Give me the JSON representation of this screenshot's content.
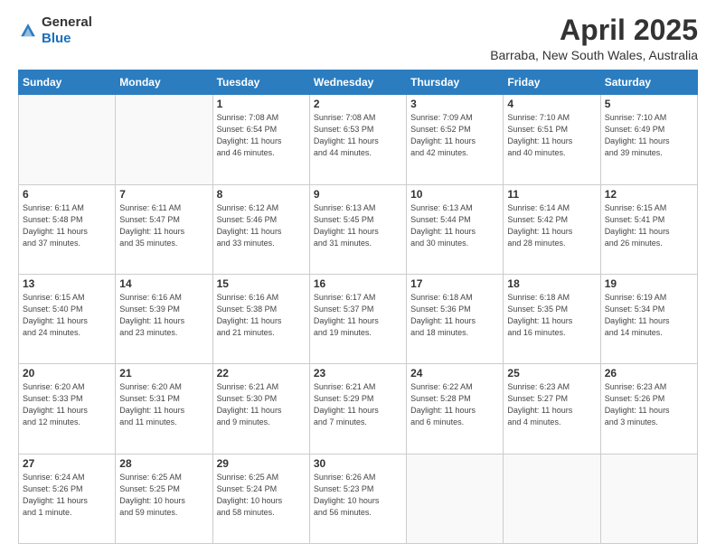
{
  "header": {
    "logo_general": "General",
    "logo_blue": "Blue",
    "title": "April 2025",
    "location": "Barraba, New South Wales, Australia"
  },
  "weekdays": [
    "Sunday",
    "Monday",
    "Tuesday",
    "Wednesday",
    "Thursday",
    "Friday",
    "Saturday"
  ],
  "weeks": [
    [
      {
        "day": "",
        "info": ""
      },
      {
        "day": "",
        "info": ""
      },
      {
        "day": "1",
        "info": "Sunrise: 7:08 AM\nSunset: 6:54 PM\nDaylight: 11 hours\nand 46 minutes."
      },
      {
        "day": "2",
        "info": "Sunrise: 7:08 AM\nSunset: 6:53 PM\nDaylight: 11 hours\nand 44 minutes."
      },
      {
        "day": "3",
        "info": "Sunrise: 7:09 AM\nSunset: 6:52 PM\nDaylight: 11 hours\nand 42 minutes."
      },
      {
        "day": "4",
        "info": "Sunrise: 7:10 AM\nSunset: 6:51 PM\nDaylight: 11 hours\nand 40 minutes."
      },
      {
        "day": "5",
        "info": "Sunrise: 7:10 AM\nSunset: 6:49 PM\nDaylight: 11 hours\nand 39 minutes."
      }
    ],
    [
      {
        "day": "6",
        "info": "Sunrise: 6:11 AM\nSunset: 5:48 PM\nDaylight: 11 hours\nand 37 minutes."
      },
      {
        "day": "7",
        "info": "Sunrise: 6:11 AM\nSunset: 5:47 PM\nDaylight: 11 hours\nand 35 minutes."
      },
      {
        "day": "8",
        "info": "Sunrise: 6:12 AM\nSunset: 5:46 PM\nDaylight: 11 hours\nand 33 minutes."
      },
      {
        "day": "9",
        "info": "Sunrise: 6:13 AM\nSunset: 5:45 PM\nDaylight: 11 hours\nand 31 minutes."
      },
      {
        "day": "10",
        "info": "Sunrise: 6:13 AM\nSunset: 5:44 PM\nDaylight: 11 hours\nand 30 minutes."
      },
      {
        "day": "11",
        "info": "Sunrise: 6:14 AM\nSunset: 5:42 PM\nDaylight: 11 hours\nand 28 minutes."
      },
      {
        "day": "12",
        "info": "Sunrise: 6:15 AM\nSunset: 5:41 PM\nDaylight: 11 hours\nand 26 minutes."
      }
    ],
    [
      {
        "day": "13",
        "info": "Sunrise: 6:15 AM\nSunset: 5:40 PM\nDaylight: 11 hours\nand 24 minutes."
      },
      {
        "day": "14",
        "info": "Sunrise: 6:16 AM\nSunset: 5:39 PM\nDaylight: 11 hours\nand 23 minutes."
      },
      {
        "day": "15",
        "info": "Sunrise: 6:16 AM\nSunset: 5:38 PM\nDaylight: 11 hours\nand 21 minutes."
      },
      {
        "day": "16",
        "info": "Sunrise: 6:17 AM\nSunset: 5:37 PM\nDaylight: 11 hours\nand 19 minutes."
      },
      {
        "day": "17",
        "info": "Sunrise: 6:18 AM\nSunset: 5:36 PM\nDaylight: 11 hours\nand 18 minutes."
      },
      {
        "day": "18",
        "info": "Sunrise: 6:18 AM\nSunset: 5:35 PM\nDaylight: 11 hours\nand 16 minutes."
      },
      {
        "day": "19",
        "info": "Sunrise: 6:19 AM\nSunset: 5:34 PM\nDaylight: 11 hours\nand 14 minutes."
      }
    ],
    [
      {
        "day": "20",
        "info": "Sunrise: 6:20 AM\nSunset: 5:33 PM\nDaylight: 11 hours\nand 12 minutes."
      },
      {
        "day": "21",
        "info": "Sunrise: 6:20 AM\nSunset: 5:31 PM\nDaylight: 11 hours\nand 11 minutes."
      },
      {
        "day": "22",
        "info": "Sunrise: 6:21 AM\nSunset: 5:30 PM\nDaylight: 11 hours\nand 9 minutes."
      },
      {
        "day": "23",
        "info": "Sunrise: 6:21 AM\nSunset: 5:29 PM\nDaylight: 11 hours\nand 7 minutes."
      },
      {
        "day": "24",
        "info": "Sunrise: 6:22 AM\nSunset: 5:28 PM\nDaylight: 11 hours\nand 6 minutes."
      },
      {
        "day": "25",
        "info": "Sunrise: 6:23 AM\nSunset: 5:27 PM\nDaylight: 11 hours\nand 4 minutes."
      },
      {
        "day": "26",
        "info": "Sunrise: 6:23 AM\nSunset: 5:26 PM\nDaylight: 11 hours\nand 3 minutes."
      }
    ],
    [
      {
        "day": "27",
        "info": "Sunrise: 6:24 AM\nSunset: 5:26 PM\nDaylight: 11 hours\nand 1 minute."
      },
      {
        "day": "28",
        "info": "Sunrise: 6:25 AM\nSunset: 5:25 PM\nDaylight: 10 hours\nand 59 minutes."
      },
      {
        "day": "29",
        "info": "Sunrise: 6:25 AM\nSunset: 5:24 PM\nDaylight: 10 hours\nand 58 minutes."
      },
      {
        "day": "30",
        "info": "Sunrise: 6:26 AM\nSunset: 5:23 PM\nDaylight: 10 hours\nand 56 minutes."
      },
      {
        "day": "",
        "info": ""
      },
      {
        "day": "",
        "info": ""
      },
      {
        "day": "",
        "info": ""
      }
    ]
  ]
}
